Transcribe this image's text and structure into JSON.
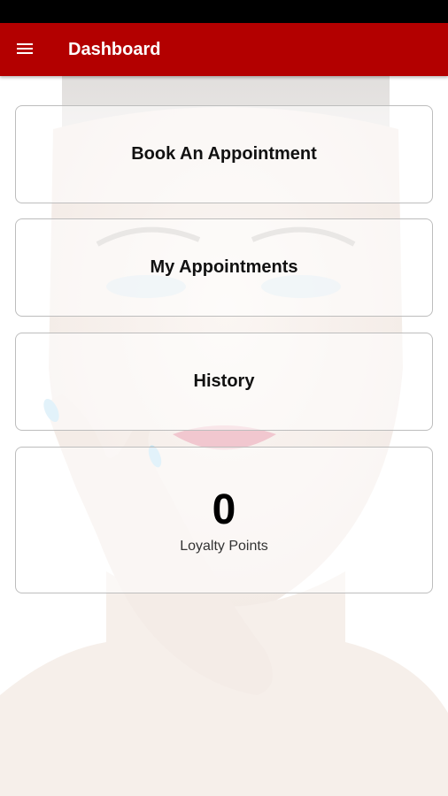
{
  "app_bar": {
    "title": "Dashboard",
    "menu_icon": "hamburger-menu-icon",
    "color": "#b30000"
  },
  "status_bar": {
    "color": "#000000"
  },
  "dashboard": {
    "book_label": "Book An Appointment",
    "appointments_label": "My Appointments",
    "history_label": "History",
    "loyalty": {
      "value": "0",
      "label": "Loyalty Points"
    }
  }
}
